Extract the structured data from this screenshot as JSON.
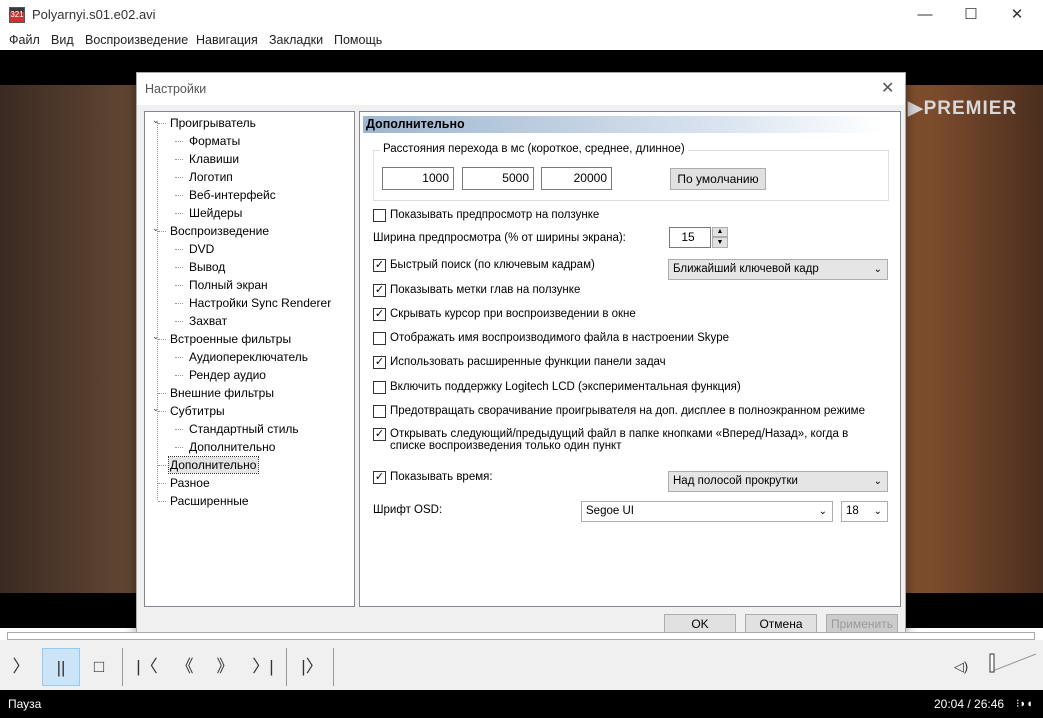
{
  "window": {
    "title": "Polyarnyi.s01.e02.avi",
    "minimize": "—",
    "maximize": "☐",
    "close": "✕"
  },
  "menu": [
    "Файл",
    "Вид",
    "Воспроизведение",
    "Навигация",
    "Закладки",
    "Помощь"
  ],
  "video": {
    "watermark": "▶PREMIER"
  },
  "dialog": {
    "title": "Настройки",
    "close": "✕",
    "tree": [
      {
        "label": "Проигрыватель",
        "level": 0,
        "exp": "⌄"
      },
      {
        "label": "Форматы",
        "level": 1
      },
      {
        "label": "Клавиши",
        "level": 1
      },
      {
        "label": "Логотип",
        "level": 1
      },
      {
        "label": "Веб-интерфейс",
        "level": 1
      },
      {
        "label": "Шейдеры",
        "level": 1
      },
      {
        "label": "Воспроизведение",
        "level": 0,
        "exp": "⌄"
      },
      {
        "label": "DVD",
        "level": 1
      },
      {
        "label": "Вывод",
        "level": 1
      },
      {
        "label": "Полный экран",
        "level": 1
      },
      {
        "label": "Настройки Sync Renderer",
        "level": 1
      },
      {
        "label": "Захват",
        "level": 1
      },
      {
        "label": "Встроенные фильтры",
        "level": 0,
        "exp": "⌄"
      },
      {
        "label": "Аудиопереключатель",
        "level": 1
      },
      {
        "label": "Рендер аудио",
        "level": 1
      },
      {
        "label": "Внешние фильтры",
        "level": 0
      },
      {
        "label": "Субтитры",
        "level": 0,
        "exp": "⌄"
      },
      {
        "label": "Стандартный стиль",
        "level": 1
      },
      {
        "label": "Дополнительно",
        "level": 1
      },
      {
        "label": "Дополнительно",
        "level": 0,
        "selected": true
      },
      {
        "label": "Разное",
        "level": 0
      },
      {
        "label": "Расширенные",
        "level": 0
      }
    ],
    "panel": {
      "header": "Дополнительно",
      "jump_group": "Расстояния перехода в мс (короткое, среднее, длинное)",
      "jump_short": "1000",
      "jump_medium": "5000",
      "jump_long": "20000",
      "default_button": "По умолчанию",
      "preview_width_label": "Ширина предпросмотра (% от ширины экрана):",
      "preview_width": "15",
      "fast_seek_combo": "Ближайший ключевой кадр",
      "time_combo": "Над полосой прокрутки",
      "osd_font_label": "Шрифт OSD:",
      "osd_font": "Segoe UI",
      "osd_size": "18",
      "checkboxes": [
        {
          "label": "Показывать предпросмотр на ползунке",
          "checked": false
        },
        {
          "label": "Быстрый поиск (по ключевым кадрам)",
          "checked": true
        },
        {
          "label": "Показывать метки глав на ползунке",
          "checked": true
        },
        {
          "label": "Скрывать курсор при воспроизведении в окне",
          "checked": true
        },
        {
          "label": "Отображать имя воспроизводимого файла в настроении Skype",
          "checked": false
        },
        {
          "label": "Использовать расширенные функции панели задач",
          "checked": true
        },
        {
          "label": "Включить поддержку Logitech LCD (экспериментальная функция)",
          "checked": false
        },
        {
          "label": "Предотвращать сворачивание проигрывателя на доп. дисплее в полноэкранном режиме",
          "checked": false
        },
        {
          "label": "Открывать следующий/предыдущий файл в папке кнопками «Вперед/Назад», когда в списке воспроизведения только один пункт",
          "checked": true
        },
        {
          "label": "Показывать время:",
          "checked": true
        }
      ]
    },
    "ok": "OK",
    "cancel": "Отмена",
    "apply": "Применить"
  },
  "controls": {
    "play": "〉",
    "pause": "||",
    "stop": "□",
    "prev": "|〈",
    "rewind": "《",
    "forward": "》",
    "next": "〉|",
    "frame_step": "|〉",
    "volume_icon": "◁)"
  },
  "status": {
    "state": "Пауза",
    "time": "20:04 / 26:46"
  }
}
